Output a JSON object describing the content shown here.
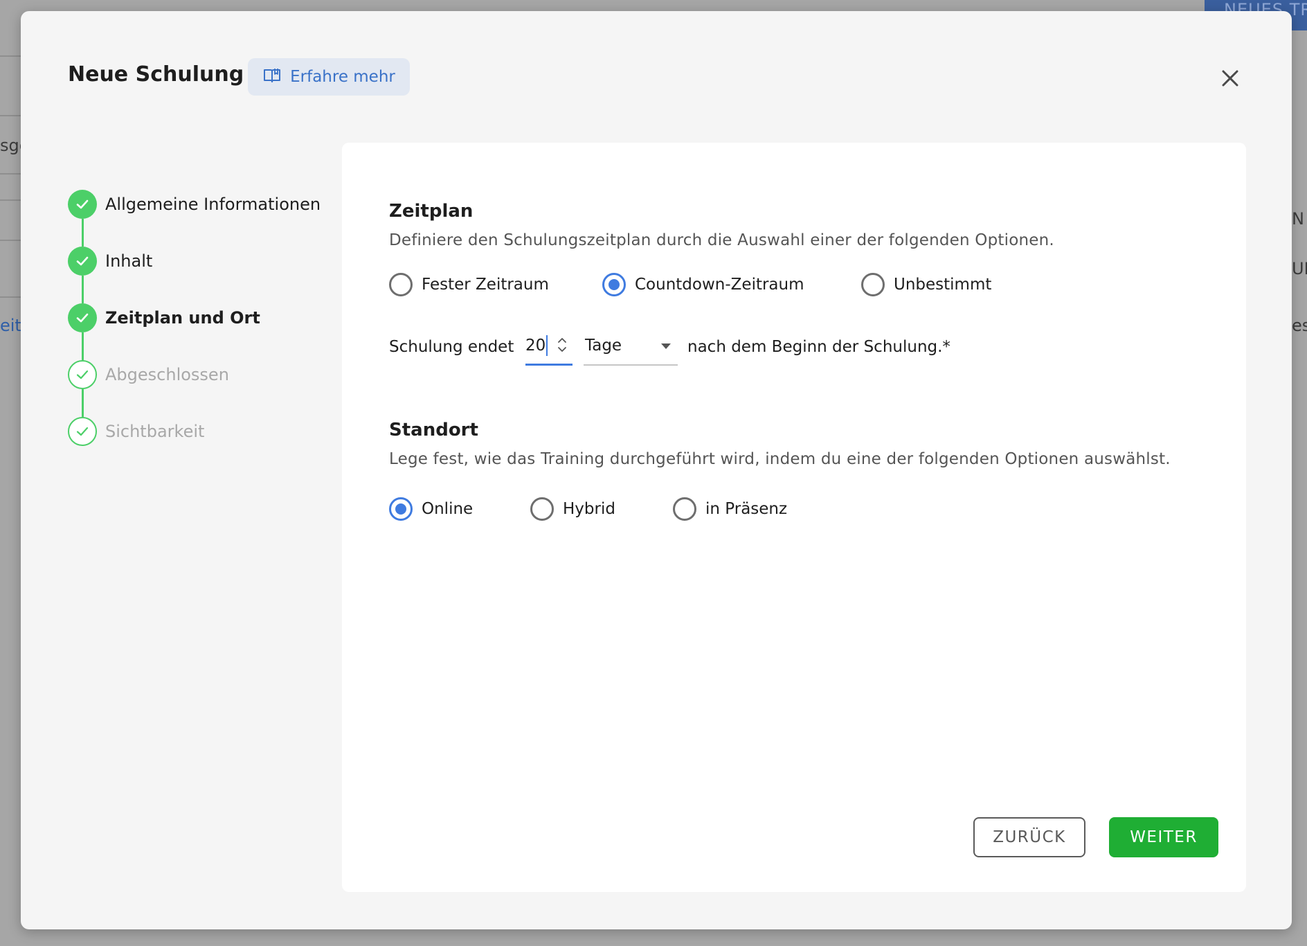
{
  "background": {
    "new_button_label": "NEUES TR",
    "fragments": [
      "sge",
      "eit",
      "N",
      "UR",
      "es"
    ]
  },
  "modal": {
    "title": "Neue Schulung",
    "learn_more_label": "Erfahre mehr",
    "learn_more_icon": "book-icon",
    "close_icon": "close-icon"
  },
  "stepper": {
    "steps": [
      {
        "label": "Allgemeine Informationen",
        "status": "completed"
      },
      {
        "label": "Inhalt",
        "status": "completed"
      },
      {
        "label": "Zeitplan und Ort",
        "status": "current"
      },
      {
        "label": "Abgeschlossen",
        "status": "pending"
      },
      {
        "label": "Sichtbarkeit",
        "status": "pending"
      }
    ]
  },
  "schedule": {
    "title": "Zeitplan",
    "description": "Definiere den Schulungszeitplan durch die Auswahl einer der folgenden Optionen.",
    "options": [
      "Fester Zeitraum",
      "Countdown-Zeitraum",
      "Unbestimmt"
    ],
    "selected": "Countdown-Zeitraum",
    "countdown": {
      "prefix": "Schulung endet",
      "value": "20",
      "unit": "Tage",
      "suffix": "nach dem Beginn der Schulung.*"
    }
  },
  "location": {
    "title": "Standort",
    "description": "Lege fest, wie das Training durchgeführt wird, indem du eine der folgenden Optionen auswählst.",
    "options": [
      "Online",
      "Hybrid",
      "in Präsenz"
    ],
    "selected": "Online"
  },
  "footer": {
    "back_label": "ZURÜCK",
    "next_label": "WEITER"
  },
  "colors": {
    "accent_blue": "#3f7be0",
    "success_green": "#4ccf68",
    "primary_button": "#1fae34"
  }
}
